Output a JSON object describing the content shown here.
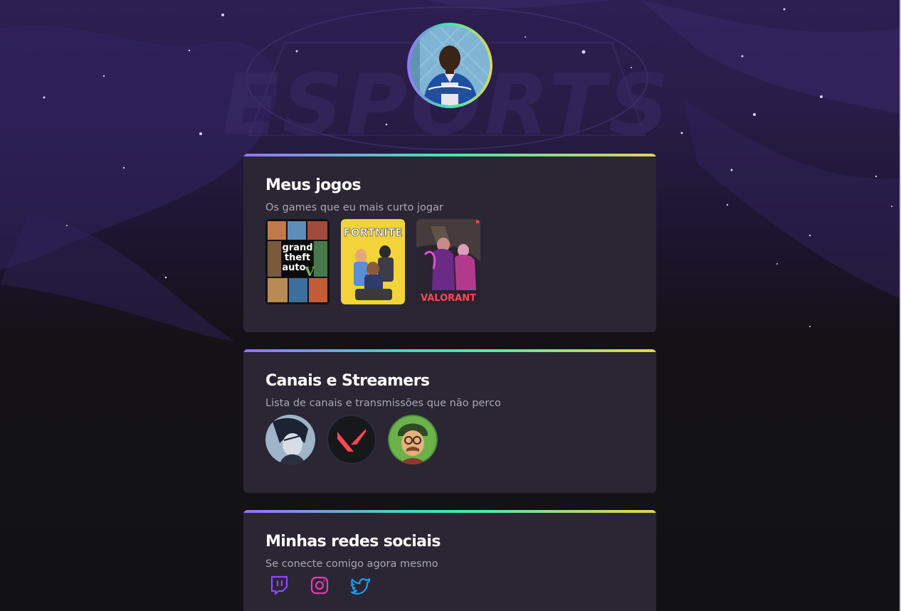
{
  "background": {
    "logo_text": "ESPORTS",
    "colors": {
      "top": "#2d1f52",
      "bottom": "#121214"
    }
  },
  "profile": {
    "avatar_icon": "profile-photo",
    "ring_colors": [
      "#9572fc",
      "#43e7ad",
      "#e2d45c"
    ]
  },
  "sections": {
    "games": {
      "title": "Meus jogos",
      "subtitle": "Os games que eu mais curto jogar",
      "items": [
        {
          "name": "Grand Theft Auto V",
          "line1": "grand",
          "line2": "theft",
          "line3": "auto",
          "mark": "V"
        },
        {
          "name": "Fortnite",
          "logo": "FORTNITE"
        },
        {
          "name": "Valorant",
          "logo": "VALORANT"
        }
      ]
    },
    "channels": {
      "title": "Canais e Streamers",
      "subtitle": "Lista de canais e transmissões que não perco",
      "items": [
        {
          "name": "streamer-anime-avatar"
        },
        {
          "name": "valorant-channel"
        },
        {
          "name": "streamer-cartoon-avatar"
        }
      ]
    },
    "socials": {
      "title": "Minhas redes sociais",
      "subtitle": "Se conecte comigo agora mesmo",
      "items": [
        {
          "name": "Twitch",
          "icon": "twitch-icon",
          "color": "#9147ff"
        },
        {
          "name": "Instagram",
          "icon": "instagram-icon",
          "color": "#e1306c"
        },
        {
          "name": "Twitter",
          "icon": "twitter-icon",
          "color": "#1d9bf0"
        }
      ]
    }
  },
  "colors": {
    "card_bg": "#2a2634",
    "title": "#ffffff",
    "subtitle": "#a8a8b3",
    "accent_gradient": [
      "#9572fc",
      "#43e7ad",
      "#e2d45c"
    ]
  }
}
